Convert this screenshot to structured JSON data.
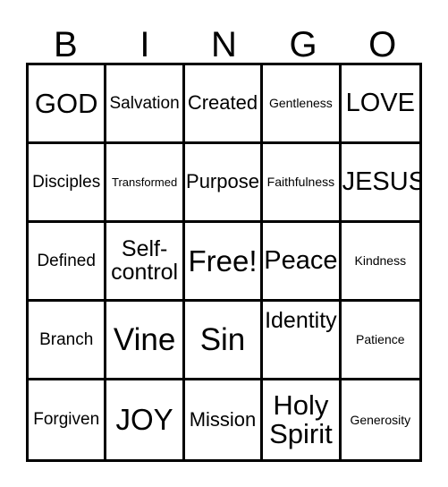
{
  "card": {
    "type": "bingo-card",
    "columns": 5,
    "rows": 5,
    "border_color": "#000000",
    "background_color": "#ffffff",
    "text_color": "#000000"
  },
  "header": {
    "letters": [
      {
        "label": "B"
      },
      {
        "label": "I"
      },
      {
        "label": "N"
      },
      {
        "label": "G"
      },
      {
        "label": "O"
      }
    ]
  },
  "grid": {
    "rows": [
      {
        "cells": [
          {
            "label": "GOD"
          },
          {
            "label": "Salvation"
          },
          {
            "label": "Created"
          },
          {
            "label": "Gentleness"
          },
          {
            "label": "LOVE"
          }
        ]
      },
      {
        "cells": [
          {
            "label": "Disciples"
          },
          {
            "label": "Transformed"
          },
          {
            "label": "Purpose"
          },
          {
            "label": "Faithfulness"
          },
          {
            "label": "JESUS"
          }
        ]
      },
      {
        "cells": [
          {
            "label": "Defined"
          },
          {
            "label": "Self-\ncontrol"
          },
          {
            "label": "Free!"
          },
          {
            "label": "Peace"
          },
          {
            "label": "Kindness"
          }
        ]
      },
      {
        "cells": [
          {
            "label": "Branch"
          },
          {
            "label": "Vine"
          },
          {
            "label": "Sin"
          },
          {
            "label": "Identity"
          },
          {
            "label": "Patience"
          }
        ]
      },
      {
        "cells": [
          {
            "label": "Forgiven"
          },
          {
            "label": "JOY"
          },
          {
            "label": "Mission"
          },
          {
            "label": "Holy\nSpirit"
          },
          {
            "label": "Generosity"
          }
        ]
      }
    ]
  }
}
